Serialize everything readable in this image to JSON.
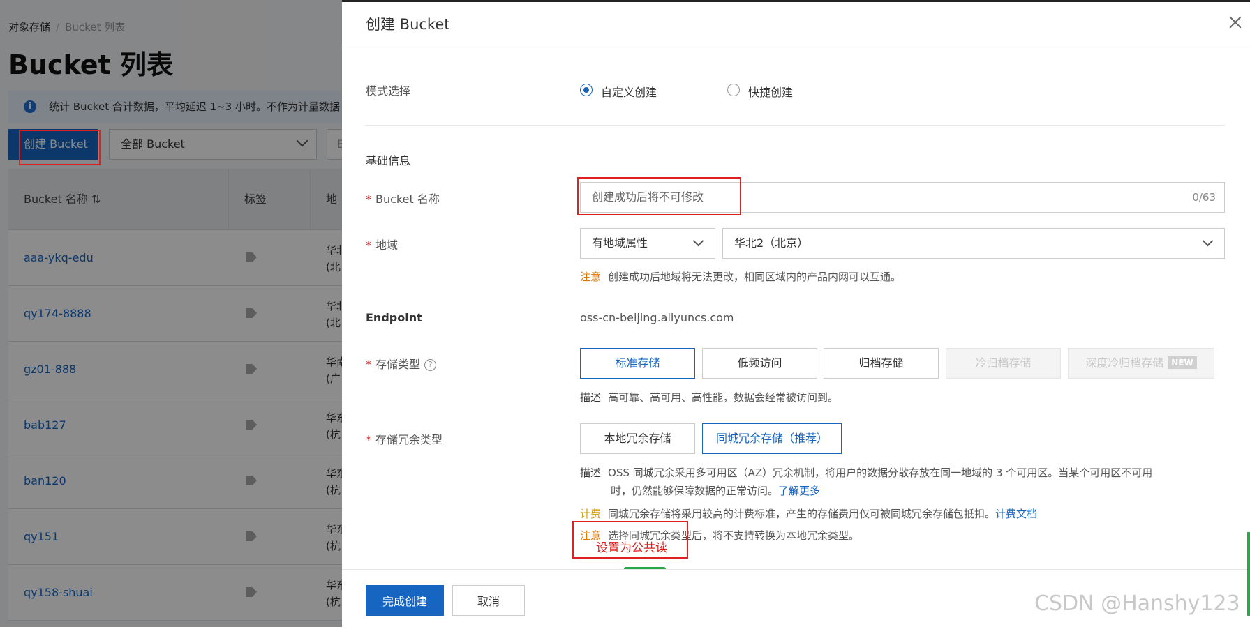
{
  "background": {
    "breadcrumb": [
      "对象存储",
      "/",
      "Bucket 列表"
    ],
    "page_title": "Bucket 列表",
    "notice": "统计 Bucket 合计数据，平均延迟 1~3 小时。不作为计量数据",
    "create_button": "创建 Bucket",
    "filter_select": "全部 Bucket",
    "filter_extra": "B",
    "table": {
      "headers": [
        "Bucket 名称",
        "标签",
        "地域"
      ],
      "rows": [
        {
          "name": "aaa-ykq-edu",
          "region": [
            "华北",
            "(北"
          ]
        },
        {
          "name": "qy174-8888",
          "region": [
            "华北",
            "(北"
          ]
        },
        {
          "name": "gz01-888",
          "region": [
            "华南",
            "(广"
          ]
        },
        {
          "name": "bab127",
          "region": [
            "华东",
            "(杭"
          ]
        },
        {
          "name": "ban120",
          "region": [
            "华东",
            "(杭"
          ]
        },
        {
          "name": "qy151",
          "region": [
            "华东",
            "(杭"
          ]
        },
        {
          "name": "qy158-shuai",
          "region": [
            "华东",
            "(杭"
          ]
        }
      ]
    }
  },
  "drawer": {
    "title": "创建 Bucket",
    "mode_label": "模式选择",
    "mode_options": [
      "自定义创建",
      "快捷创建"
    ],
    "mode_selected": "自定义创建",
    "basic_info": "基础信息",
    "bucket_name_label": "Bucket 名称",
    "bucket_name_placeholder": "创建成功后将不可修改",
    "bucket_name_counter": "0/63",
    "region_label": "地域",
    "region_type": "有地域属性",
    "region_value": "华北2（北京）",
    "region_note_kw": "注意",
    "region_note": "创建成功后地域将无法更改，相同区域内的产品内网可以互通。",
    "endpoint_label": "Endpoint",
    "endpoint_value": "oss-cn-beijing.aliyuncs.com",
    "storage_class_label": "存储类型",
    "storage_class_options": [
      "标准存储",
      "低频访问",
      "归档存储",
      "冷归档存储",
      "深度冷归档存储"
    ],
    "storage_class_selected": "标准存储",
    "new_badge": "NEW",
    "storage_desc_kw": "描述",
    "storage_desc": "高可靠、高可用、高性能，数据会经常被访问到。",
    "redundancy_label": "存储冗余类型",
    "redundancy_options": [
      "本地冗余存储",
      "同城冗余存储（推荐）"
    ],
    "redundancy_selected": "同城冗余存储（推荐）",
    "redundancy_desc_kw": "描述",
    "redundancy_desc_1": "OSS 同城冗余采用多可用区（AZ）冗余机制，将用户的数据分散存放在同一地域的 3 个可用区。当某个可用区不可用",
    "redundancy_desc_2": "时，仍然能够保障数据的正常访问。",
    "learn_more": "了解更多",
    "billing_kw": "计费",
    "billing_text": "同城冗余存储将采用较高的计费标准，产生的存储费用仅可被同城冗余存储包抵扣。",
    "billing_link": "计费文档",
    "redundancy_note_kw": "注意",
    "redundancy_note": "选择同城冗余类型后，将不支持转换为本地冗余类型。",
    "annotation_text": "设置为公共读",
    "submit_button": "完成创建",
    "cancel_button": "取消"
  },
  "watermark": "CSDN @Hanshy123",
  "colors": {
    "primary": "#1665c1",
    "warning": "#e07800",
    "billing": "#d39a00",
    "annotation": "#e02020"
  }
}
